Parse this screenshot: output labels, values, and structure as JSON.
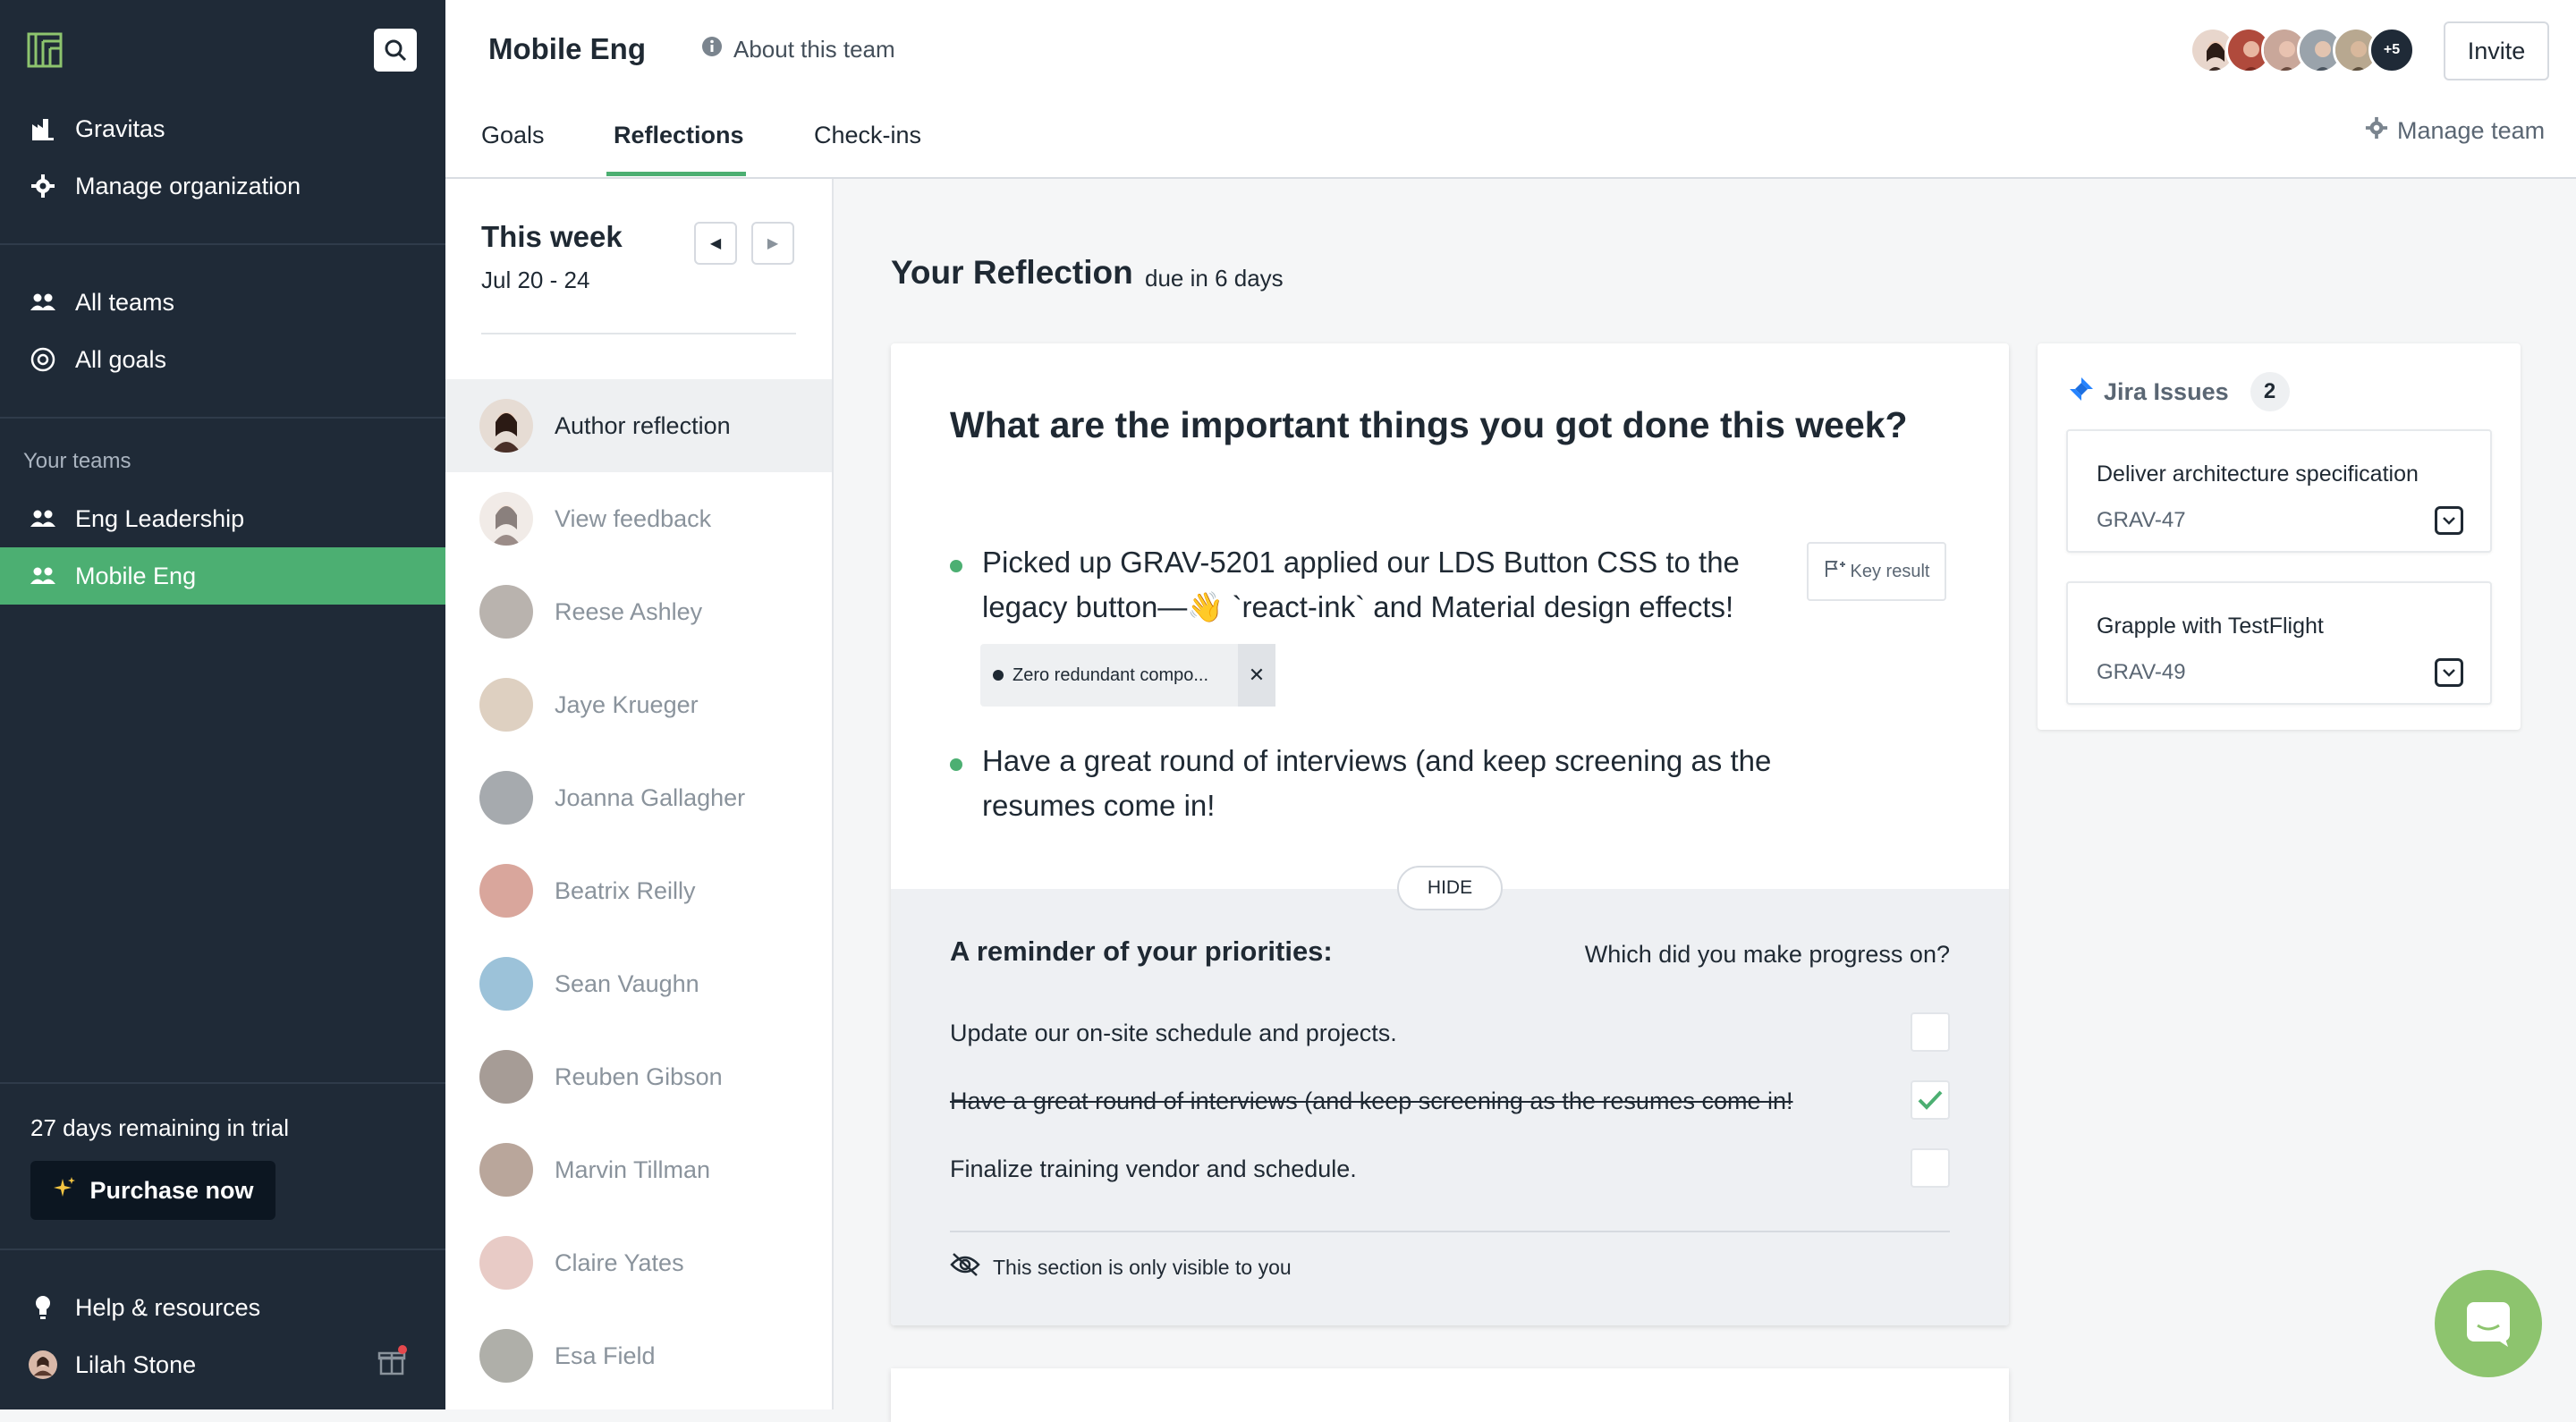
{
  "sidebar": {
    "org_name": "Gravitas",
    "manage_org": "Manage organization",
    "all_teams": "All teams",
    "all_goals": "All goals",
    "your_teams_label": "Your teams",
    "teams": [
      "Eng Leadership",
      "Mobile Eng"
    ],
    "trial_text": "27 days remaining in trial",
    "purchase_label": "Purchase now",
    "help": "Help & resources",
    "user": "Lilah Stone",
    "accent": "#4caf72",
    "bg": "#1f2a37"
  },
  "header": {
    "team_title": "Mobile Eng",
    "about": "About this team",
    "tabs": [
      "Goals",
      "Reflections",
      "Check-ins"
    ],
    "active_tab": "Reflections",
    "more_members": "+5",
    "invite": "Invite",
    "manage_team": "Manage team"
  },
  "week": {
    "title": "This week",
    "range": "Jul 20 - 24",
    "people": [
      "Author reflection",
      "View feedback",
      "Reese Ashley",
      "Jaye Krueger",
      "Joanna Gallagher",
      "Beatrix Reilly",
      "Sean Vaughn",
      "Reuben Gibson",
      "Marvin Tillman",
      "Claire Yates",
      "Esa Field"
    ]
  },
  "reflection": {
    "title": "Your Reflection",
    "due": "due in 6 days",
    "question": "What are the important things you got done this week?",
    "bullets": [
      "Picked up GRAV-5201 applied our LDS Button CSS to the legacy button—👋  `react-ink` and Material design effects!",
      "Have a great round of interviews (and keep screening as the resumes come in!"
    ],
    "key_result_label": "Key result",
    "tag": "Zero redundant compo...",
    "hide": "HIDE",
    "priorities_title": "A reminder of your priorities:",
    "progress_q": "Which did you make progress on?",
    "priorities": [
      {
        "text": "Update our on-site schedule and projects.",
        "checked": false
      },
      {
        "text": "Have a great round of interviews (and keep screening as the resumes come in!",
        "checked": true
      },
      {
        "text": "Finalize training vendor and schedule.",
        "checked": false
      }
    ],
    "visibility_note": "This section is only visible to you"
  },
  "jira": {
    "title": "Jira Issues",
    "count": "2",
    "issues": [
      {
        "title": "Deliver architecture specification",
        "key": "GRAV-47"
      },
      {
        "title": "Grapple with TestFlight",
        "key": "GRAV-49"
      }
    ]
  }
}
